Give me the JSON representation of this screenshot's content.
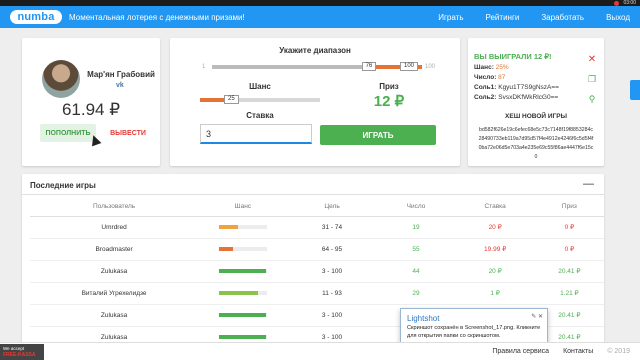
{
  "system": {
    "time": "03:00"
  },
  "header": {
    "logo": "numba",
    "tagline": "Моментальная лотерея с денежными призами!",
    "nav": [
      "Играть",
      "Рейтинги",
      "Заработать",
      "Выход"
    ]
  },
  "profile": {
    "name": "Мар'ян Грабовий",
    "social": "vk",
    "balance": "61.94 ₽",
    "deposit_label": "ПОПОЛНИТЬ",
    "withdraw_label": "ВЫВЕСТИ"
  },
  "game": {
    "range_title": "Укажите диапазон",
    "range_min": "1",
    "range_max": "100",
    "range_low": "76",
    "range_high": "100",
    "range_low_fraction": 0.76,
    "chance_label": "Шанс",
    "chance_value": "25",
    "chance_fraction": 0.25,
    "prize_label": "Приз",
    "prize_value": "12 ₽",
    "bet_label": "Ставка",
    "bet_value": "3",
    "play_label": "ИГРАТЬ"
  },
  "win": {
    "title": "ВЫ ВЫИГРАЛИ 12 ₽!",
    "chance_label": "Шанс:",
    "chance_value": "25%",
    "number_label": "Число:",
    "number_value": "87",
    "salt1_label": "Соль1:",
    "salt1_value": "Kgyu1T7S9gNszA==",
    "salt2_label": "Соль2:",
    "salt2_value": "SvsxDKfWkRlcG0==",
    "hash_title": "ХЕШ НОВОЙ ИГРЫ",
    "hash": "bd582f626e19c6efec68e5c73c7148f19f8853284c28490733eb119a7d95d57f4e4912e4246f6c5d5f4f0ba72e06d5e703a4e235e69c55f86ae4447f6e15c0"
  },
  "recent": {
    "title": "Последние игры",
    "columns": [
      "Пользователь",
      "Шанс",
      "Цель",
      "Число",
      "Ставка",
      "Приз"
    ],
    "rows": [
      {
        "user": "Umrdred",
        "chance": 0.4,
        "chance_color": "#f0a33c",
        "target": "31 - 74",
        "number": "19",
        "bet": "20 ₽",
        "bet_red": true,
        "prize": "0 ₽",
        "prize_red": true
      },
      {
        "user": "Broadmaster",
        "chance": 0.3,
        "chance_color": "#e57335",
        "target": "64 - 95",
        "number": "55",
        "bet": "19.99 ₽",
        "bet_red": true,
        "prize": "0 ₽",
        "prize_red": true
      },
      {
        "user": "Zulukasa",
        "chance": 0.98,
        "chance_color": "#4caf50",
        "target": "3 - 100",
        "number": "44",
        "bet": "20 ₽",
        "bet_red": false,
        "prize": "20.41 ₽",
        "prize_red": false
      },
      {
        "user": "Виталий Угрехелидзе",
        "chance": 0.82,
        "chance_color": "#8bc34a",
        "target": "11 - 93",
        "number": "29",
        "bet": "1 ₽",
        "bet_red": false,
        "prize": "1.21 ₽",
        "prize_red": false
      },
      {
        "user": "Zulukasa",
        "chance": 0.98,
        "chance_color": "#4caf50",
        "target": "3 - 100",
        "number": "40",
        "bet": "",
        "bet_red": false,
        "prize": "20.41 ₽",
        "prize_red": false
      },
      {
        "user": "Zulukasa",
        "chance": 0.98,
        "chance_color": "#4caf50",
        "target": "3 - 100",
        "number": "40",
        "bet": "",
        "bet_red": false,
        "prize": "20.41 ₽",
        "prize_red": false
      }
    ]
  },
  "toast": {
    "title": "Lightshot",
    "body": "Скриншот сохранён в Screenshot_17.png. Кликните для открытия папки со скриншотом."
  },
  "footer": {
    "rules": "Правила сервиса",
    "contacts": "Контакты",
    "copyright": "© 2019",
    "freekassa_line1": "We accept",
    "freekassa_line2": "FREE-KASSA"
  },
  "colors": {
    "primary": "#2196f3",
    "success": "#4caf50",
    "danger": "#e53935",
    "accent": "#e57335"
  }
}
